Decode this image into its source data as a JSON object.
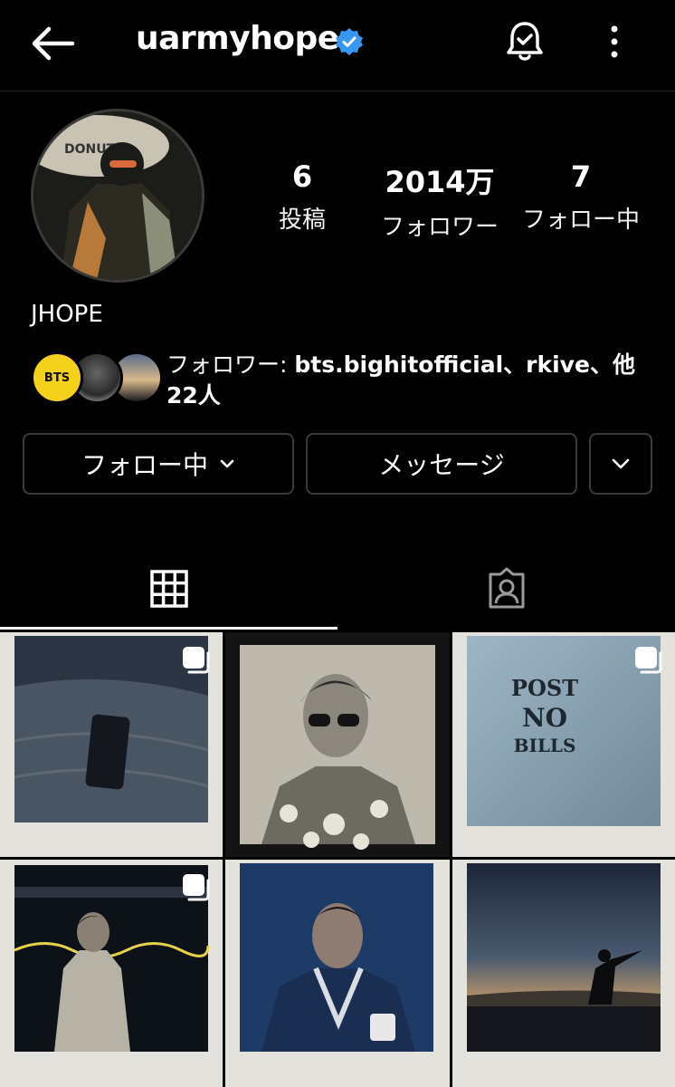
{
  "header": {
    "username": "uarmyhope",
    "back_icon": "arrow-left-icon",
    "verified_icon": "verified-badge-icon",
    "notify_icon": "bell-check-icon",
    "more_icon": "vertical-dots-icon",
    "accent_color": "#3897f0"
  },
  "profile": {
    "display_name": "JHOPE",
    "stats": [
      {
        "value": "6",
        "label": "投稿"
      },
      {
        "value": "2014万",
        "label": "フォロワー"
      },
      {
        "value": "7",
        "label": "フォロー中"
      }
    ],
    "mutual": {
      "prefix": "フォロワー: ",
      "names": "bts.bighitofficial、rkive、",
      "suffix": "他",
      "line2": "22人",
      "first_avatar_text": "BTS"
    }
  },
  "actions": {
    "follow_label": "フォロー中",
    "message_label": "メッセージ",
    "suggest_icon": "chevron-down-icon"
  },
  "tabs": [
    {
      "name": "posts",
      "icon": "grid-icon",
      "active": true
    },
    {
      "name": "tagged",
      "icon": "tagged-person-icon",
      "active": false
    }
  ],
  "posts": [
    {
      "subject": "phone in sand polaroid",
      "multi": true
    },
    {
      "subject": "portrait with sunglasses polaroid",
      "multi": false
    },
    {
      "subject": "POST NO BILLS wall polaroid",
      "multi": true,
      "text_lines": [
        "POST",
        "NO",
        "BILLS"
      ]
    },
    {
      "subject": "night portrait polaroid",
      "multi": true
    },
    {
      "subject": "blue hoodie portrait polaroid",
      "multi": false
    },
    {
      "subject": "sunset beach silhouette polaroid",
      "multi": false
    }
  ]
}
